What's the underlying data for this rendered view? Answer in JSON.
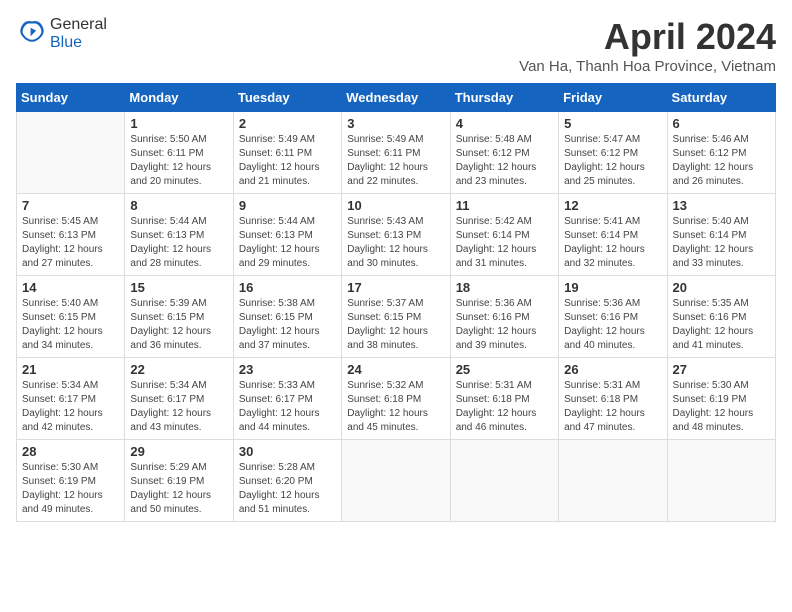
{
  "logo": {
    "general": "General",
    "blue": "Blue"
  },
  "header": {
    "month": "April 2024",
    "location": "Van Ha, Thanh Hoa Province, Vietnam"
  },
  "weekdays": [
    "Sunday",
    "Monday",
    "Tuesday",
    "Wednesday",
    "Thursday",
    "Friday",
    "Saturday"
  ],
  "weeks": [
    [
      {
        "day": null,
        "info": null
      },
      {
        "day": "1",
        "sunrise": "5:50 AM",
        "sunset": "6:11 PM",
        "daylight": "12 hours and 20 minutes."
      },
      {
        "day": "2",
        "sunrise": "5:49 AM",
        "sunset": "6:11 PM",
        "daylight": "12 hours and 21 minutes."
      },
      {
        "day": "3",
        "sunrise": "5:49 AM",
        "sunset": "6:11 PM",
        "daylight": "12 hours and 22 minutes."
      },
      {
        "day": "4",
        "sunrise": "5:48 AM",
        "sunset": "6:12 PM",
        "daylight": "12 hours and 23 minutes."
      },
      {
        "day": "5",
        "sunrise": "5:47 AM",
        "sunset": "6:12 PM",
        "daylight": "12 hours and 25 minutes."
      },
      {
        "day": "6",
        "sunrise": "5:46 AM",
        "sunset": "6:12 PM",
        "daylight": "12 hours and 26 minutes."
      }
    ],
    [
      {
        "day": "7",
        "sunrise": "5:45 AM",
        "sunset": "6:13 PM",
        "daylight": "12 hours and 27 minutes."
      },
      {
        "day": "8",
        "sunrise": "5:44 AM",
        "sunset": "6:13 PM",
        "daylight": "12 hours and 28 minutes."
      },
      {
        "day": "9",
        "sunrise": "5:44 AM",
        "sunset": "6:13 PM",
        "daylight": "12 hours and 29 minutes."
      },
      {
        "day": "10",
        "sunrise": "5:43 AM",
        "sunset": "6:13 PM",
        "daylight": "12 hours and 30 minutes."
      },
      {
        "day": "11",
        "sunrise": "5:42 AM",
        "sunset": "6:14 PM",
        "daylight": "12 hours and 31 minutes."
      },
      {
        "day": "12",
        "sunrise": "5:41 AM",
        "sunset": "6:14 PM",
        "daylight": "12 hours and 32 minutes."
      },
      {
        "day": "13",
        "sunrise": "5:40 AM",
        "sunset": "6:14 PM",
        "daylight": "12 hours and 33 minutes."
      }
    ],
    [
      {
        "day": "14",
        "sunrise": "5:40 AM",
        "sunset": "6:15 PM",
        "daylight": "12 hours and 34 minutes."
      },
      {
        "day": "15",
        "sunrise": "5:39 AM",
        "sunset": "6:15 PM",
        "daylight": "12 hours and 36 minutes."
      },
      {
        "day": "16",
        "sunrise": "5:38 AM",
        "sunset": "6:15 PM",
        "daylight": "12 hours and 37 minutes."
      },
      {
        "day": "17",
        "sunrise": "5:37 AM",
        "sunset": "6:15 PM",
        "daylight": "12 hours and 38 minutes."
      },
      {
        "day": "18",
        "sunrise": "5:36 AM",
        "sunset": "6:16 PM",
        "daylight": "12 hours and 39 minutes."
      },
      {
        "day": "19",
        "sunrise": "5:36 AM",
        "sunset": "6:16 PM",
        "daylight": "12 hours and 40 minutes."
      },
      {
        "day": "20",
        "sunrise": "5:35 AM",
        "sunset": "6:16 PM",
        "daylight": "12 hours and 41 minutes."
      }
    ],
    [
      {
        "day": "21",
        "sunrise": "5:34 AM",
        "sunset": "6:17 PM",
        "daylight": "12 hours and 42 minutes."
      },
      {
        "day": "22",
        "sunrise": "5:34 AM",
        "sunset": "6:17 PM",
        "daylight": "12 hours and 43 minutes."
      },
      {
        "day": "23",
        "sunrise": "5:33 AM",
        "sunset": "6:17 PM",
        "daylight": "12 hours and 44 minutes."
      },
      {
        "day": "24",
        "sunrise": "5:32 AM",
        "sunset": "6:18 PM",
        "daylight": "12 hours and 45 minutes."
      },
      {
        "day": "25",
        "sunrise": "5:31 AM",
        "sunset": "6:18 PM",
        "daylight": "12 hours and 46 minutes."
      },
      {
        "day": "26",
        "sunrise": "5:31 AM",
        "sunset": "6:18 PM",
        "daylight": "12 hours and 47 minutes."
      },
      {
        "day": "27",
        "sunrise": "5:30 AM",
        "sunset": "6:19 PM",
        "daylight": "12 hours and 48 minutes."
      }
    ],
    [
      {
        "day": "28",
        "sunrise": "5:30 AM",
        "sunset": "6:19 PM",
        "daylight": "12 hours and 49 minutes."
      },
      {
        "day": "29",
        "sunrise": "5:29 AM",
        "sunset": "6:19 PM",
        "daylight": "12 hours and 50 minutes."
      },
      {
        "day": "30",
        "sunrise": "5:28 AM",
        "sunset": "6:20 PM",
        "daylight": "12 hours and 51 minutes."
      },
      {
        "day": null,
        "info": null
      },
      {
        "day": null,
        "info": null
      },
      {
        "day": null,
        "info": null
      },
      {
        "day": null,
        "info": null
      }
    ]
  ]
}
